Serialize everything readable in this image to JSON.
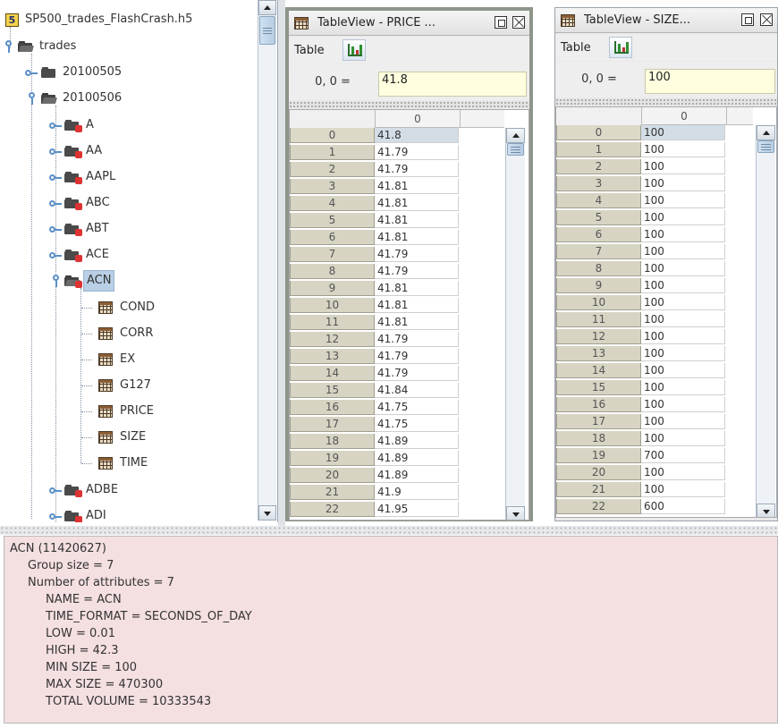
{
  "tree": {
    "file": "SP500_trades_FlashCrash.h5",
    "file_badge": "5",
    "root": "trades",
    "groups": [
      "20100505",
      "20100506"
    ],
    "symbols_before": [
      "A",
      "AA",
      "AAPL",
      "ABC",
      "ABT",
      "ACE"
    ],
    "selected": "ACN",
    "datasets": [
      "COND",
      "CORR",
      "EX",
      "G127",
      "PRICE",
      "SIZE",
      "TIME"
    ],
    "symbols_after": [
      "ADBE",
      "ADI"
    ]
  },
  "price_view": {
    "title": "TableView  -  PRICE ...",
    "menu_table": "Table",
    "cell_ref": "0, 0  =",
    "cell_value": "41.8",
    "col_header": "0",
    "row_labels": [
      "0",
      "1",
      "2",
      "3",
      "4",
      "5",
      "6",
      "7",
      "8",
      "9",
      "10",
      "11",
      "12",
      "13",
      "14",
      "15",
      "16",
      "17",
      "18",
      "19",
      "20",
      "21",
      "22"
    ],
    "values": [
      "41.8",
      "41.79",
      "41.79",
      "41.81",
      "41.81",
      "41.81",
      "41.81",
      "41.79",
      "41.79",
      "41.81",
      "41.81",
      "41.81",
      "41.79",
      "41.79",
      "41.79",
      "41.84",
      "41.75",
      "41.75",
      "41.89",
      "41.89",
      "41.89",
      "41.9",
      "41.95"
    ]
  },
  "size_view": {
    "title": "TableView  -  SIZE...",
    "menu_table": "Table",
    "cell_ref": "0, 0  =",
    "cell_value": "100",
    "col_header": "0",
    "row_labels": [
      "0",
      "1",
      "2",
      "3",
      "4",
      "5",
      "6",
      "7",
      "8",
      "9",
      "10",
      "11",
      "12",
      "13",
      "14",
      "15",
      "16",
      "17",
      "18",
      "19",
      "20",
      "21",
      "22"
    ],
    "values": [
      "100",
      "100",
      "100",
      "100",
      "100",
      "100",
      "100",
      "100",
      "100",
      "100",
      "100",
      "100",
      "100",
      "100",
      "100",
      "100",
      "100",
      "100",
      "100",
      "700",
      "100",
      "100",
      "600"
    ]
  },
  "info": {
    "header": "ACN (11420627)",
    "group_size": "Group size = 7",
    "num_attributes": "Number of attributes = 7",
    "attributes": [
      "NAME = ACN",
      "TIME_FORMAT = SECONDS_OF_DAY",
      "LOW = 0.01",
      "HIGH = 42.3",
      "MIN SIZE = 100",
      "MAX SIZE = 470300",
      "TOTAL VOLUME = 10333543"
    ]
  }
}
